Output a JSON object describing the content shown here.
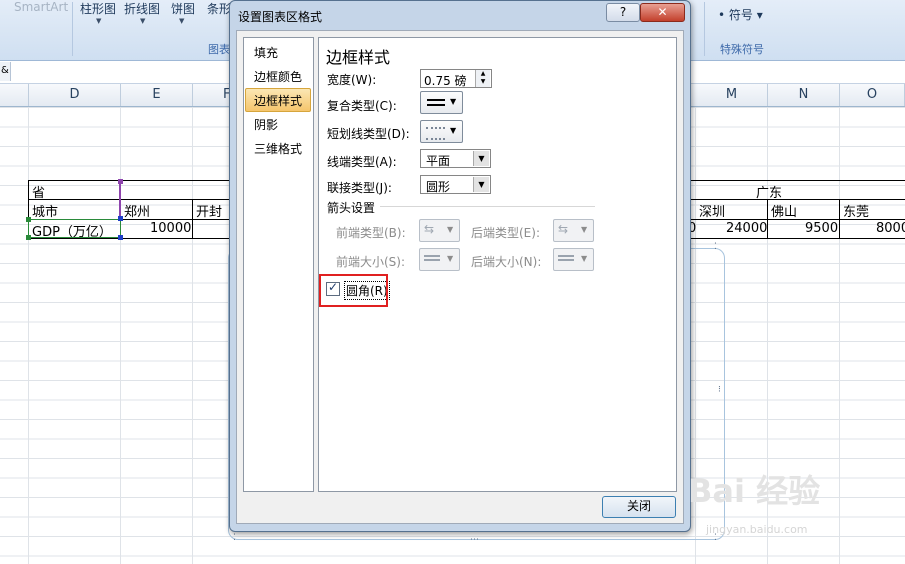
{
  "ribbon": {
    "smartart": "SmartArt",
    "bar_chart": "柱形图",
    "line_chart": "折线图",
    "pie_chart": "饼图",
    "strip": "条形",
    "group_chart": "图表",
    "symbol": "符号",
    "group_special": "特殊符号"
  },
  "formula": {
    "fx": "&"
  },
  "columns": [
    "D",
    "E",
    "F",
    "M",
    "N",
    "O"
  ],
  "sheet": {
    "province_label": "省",
    "province_value": "广东",
    "city_label": "城市",
    "gdp_label": "GDP（万亿）",
    "cities_left": [
      "郑州",
      "开封"
    ],
    "cities_right": [
      "深圳",
      "佛山",
      "东莞"
    ],
    "gdp_left": [
      "10000"
    ],
    "gdp_right": [
      "0",
      "24000",
      "9500",
      "8000"
    ]
  },
  "dialog": {
    "title": "设置图表区格式",
    "help": "?",
    "close_x": "✕",
    "nav": [
      "填充",
      "边框颜色",
      "边框样式",
      "阴影",
      "三维格式"
    ],
    "panel_title": "边框样式",
    "width_label": "宽度(W):",
    "width_value": "0.75 磅",
    "compound_label": "复合类型(C):",
    "dash_label": "短划线类型(D):",
    "cap_label": "线端类型(A):",
    "cap_value": "平面",
    "join_label": "联接类型(J):",
    "join_value": "圆形",
    "arrow_section": "箭头设置",
    "begin_type": "前端类型(B):",
    "end_type": "后端类型(E):",
    "begin_size": "前端大小(S):",
    "end_size": "后端大小(N):",
    "rounded_label": "圆角(R)",
    "rounded_checked": "✓",
    "close_button": "关闭"
  },
  "watermark": {
    "brand": "Bai 经验",
    "url": "jingyan.baidu.com"
  }
}
